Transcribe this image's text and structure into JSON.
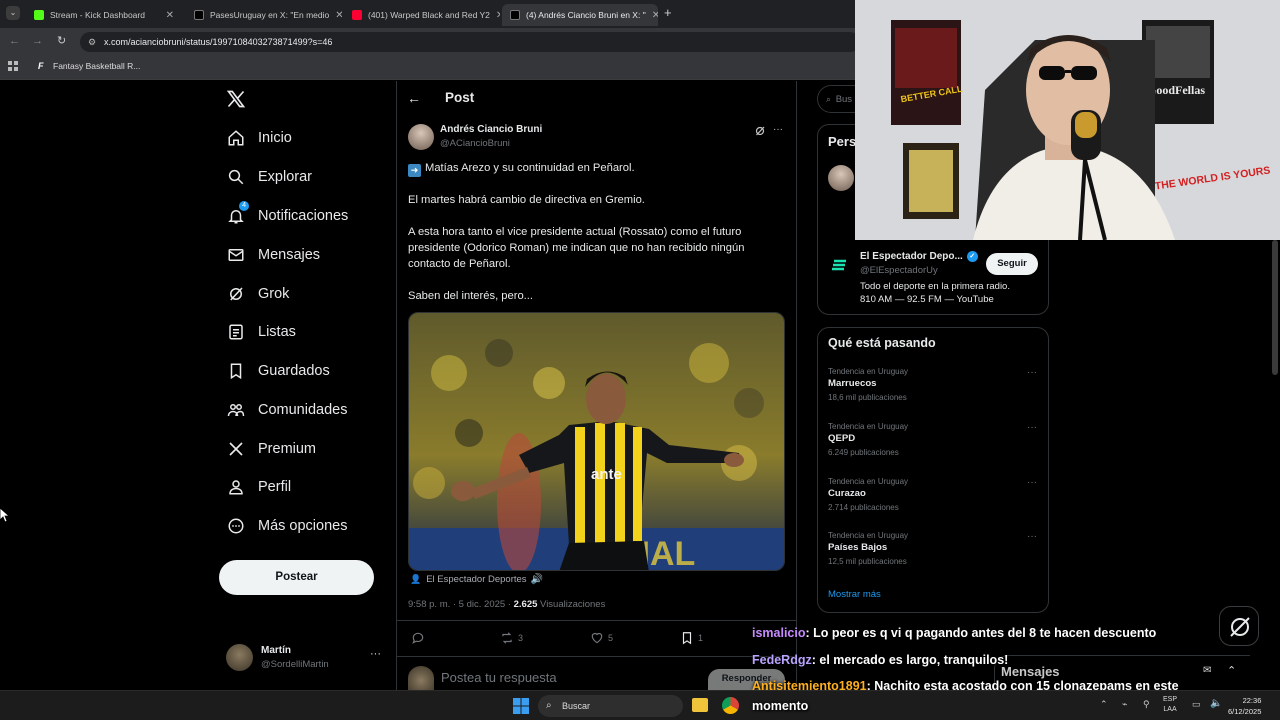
{
  "browser": {
    "tabs": [
      {
        "label": "Stream - Kick Dashboard",
        "color": "#53fc18"
      },
      {
        "label": "PasesUruguay en X: \"En medio",
        "color": "#e7e9ea"
      },
      {
        "label": "(401) Warped Black and Red Y2",
        "color": "#ff0033"
      },
      {
        "label": "(4) Andrés Ciancio Bruni en X: \"",
        "color": "#e7e9ea"
      }
    ],
    "url": "x.com/acianciobruni/status/1997108403273871499?s=46",
    "bookmark": "Fantasy Basketball R..."
  },
  "nav": {
    "items": [
      {
        "label": "Inicio",
        "icon": "home-icon"
      },
      {
        "label": "Explorar",
        "icon": "search-icon"
      },
      {
        "label": "Notificaciones",
        "icon": "bell-icon",
        "badge": "4"
      },
      {
        "label": "Mensajes",
        "icon": "mail-icon"
      },
      {
        "label": "Grok",
        "icon": "grok-icon"
      },
      {
        "label": "Listas",
        "icon": "list-icon"
      },
      {
        "label": "Guardados",
        "icon": "bookmark-icon"
      },
      {
        "label": "Comunidades",
        "icon": "people-icon"
      },
      {
        "label": "Premium",
        "icon": "x-icon"
      },
      {
        "label": "Perfil",
        "icon": "person-icon"
      },
      {
        "label": "Más opciones",
        "icon": "more-circle-icon"
      }
    ],
    "post_button": "Postear",
    "account": {
      "name": "Martín",
      "handle": "@SordelliMartin"
    }
  },
  "post": {
    "header": "Post",
    "author": {
      "name": "Andrés Ciancio Bruni",
      "handle": "@ACiancioBruni"
    },
    "paragraphs": [
      "Matías Arezo y su continuidad en Peñarol.",
      "El martes habrá cambio de directiva en Gremio.",
      "A esta hora tanto el vice presidente actual (Rossato) como el futuro presidente (Odorico Roman) me indican que no han recibido ningún contacto de Peñarol.",
      "Saben del interés, pero..."
    ],
    "image_credit": "El Espectador Deportes",
    "timestamp": "9:58 p. m. · 5 dic. 2025 · ",
    "views_count": "2.625",
    "views_label": " Visualizaciones",
    "actions": {
      "reposts": "3",
      "likes": "5",
      "bookmarks": "1"
    },
    "reply_placeholder": "Postea tu respuesta",
    "reply_button": "Responder"
  },
  "sidebar": {
    "search_placeholder": "Bus",
    "who_to_follow_title": "Pers",
    "suggested": {
      "name": "El Espectador Depo...",
      "handle": "@ElEspectadorUy",
      "follow": "Seguir",
      "bio": "Todo el deporte en la primera radio. 810 AM — 92.5 FM — YouTube"
    },
    "trends_title": "Qué está pasando",
    "trends": [
      {
        "meta": "Tendencia en Uruguay",
        "name": "Marruecos",
        "count": "18,6 mil publicaciones"
      },
      {
        "meta": "Tendencia en Uruguay",
        "name": "QEPD",
        "count": "6.249 publicaciones"
      },
      {
        "meta": "Tendencia en Uruguay",
        "name": "Curazao",
        "count": "2.714 publicaciones"
      },
      {
        "meta": "Tendencia en Uruguay",
        "name": "Países Bajos",
        "count": "12,5 mil publicaciones"
      }
    ],
    "show_more": "Mostrar más",
    "messages_drawer": "Mensajes"
  },
  "webcam": {
    "posters": [
      "Better Call Saul",
      "GoodFellas"
    ],
    "sign": "THE WORLD IS YOURS"
  },
  "chat": [
    {
      "user": "ismalicio",
      "color": "#c88bff",
      "text": ": Lo peor es q vi q pagando antes del 8 te hacen descuento"
    },
    {
      "user": "FedeRdgz",
      "color": "#b9a3ff",
      "text": ": el mercado es largo, tranquilos!"
    },
    {
      "user": "Antisitemiento1891",
      "color": "#ffb020",
      "text": ": Nachito esta acostado con 15 clonazepams en este"
    },
    {
      "user": "",
      "color": "#ffffff",
      "text": "momento"
    }
  ],
  "taskbar": {
    "search": "Buscar",
    "lang_top": "ESP",
    "lang_bottom": "LAA",
    "time": "22:36",
    "date": "6/12/2025"
  }
}
